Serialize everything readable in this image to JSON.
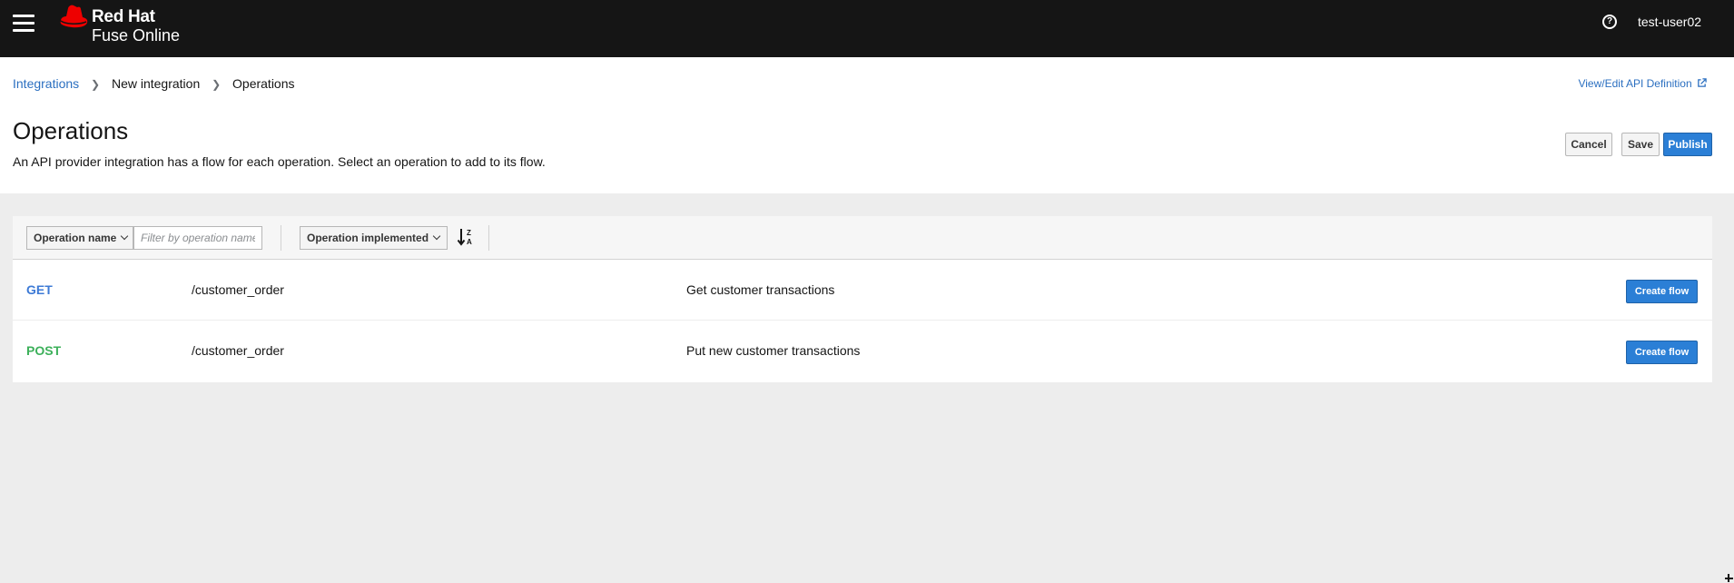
{
  "masthead": {
    "brand_line1": "Red Hat",
    "brand_line2": "Fuse Online",
    "username": "test-user02",
    "menu_icon": "hamburger-menu-icon",
    "help_icon": "help-circle-icon"
  },
  "breadcrumb": {
    "items": [
      "Integrations",
      "New integration",
      "Operations"
    ]
  },
  "header": {
    "title": "Operations",
    "description": "An API provider integration has a flow for each operation. Select an operation to add to its flow.",
    "view_edit_link": "View/Edit API Definition",
    "cancel_label": "Cancel",
    "save_label": "Save",
    "publish_label": "Publish"
  },
  "toolbar": {
    "filter_field": "Operation name",
    "filter_placeholder": "Filter by operation name",
    "sort_field": "Operation implemented",
    "sort_icon": "sort-alpha-desc-icon"
  },
  "operations": [
    {
      "method": "GET",
      "method_color": "#3d7ad6",
      "path": "/customer_order",
      "description": "Get customer transactions",
      "action_label": "Create flow"
    },
    {
      "method": "POST",
      "method_color": "#3cb05a",
      "path": "/customer_order",
      "description": "Put new customer transactions",
      "action_label": "Create flow"
    }
  ],
  "colors": {
    "masthead_bg": "#151515",
    "primary": "#2b7fd6",
    "link": "#2b6fc0"
  }
}
